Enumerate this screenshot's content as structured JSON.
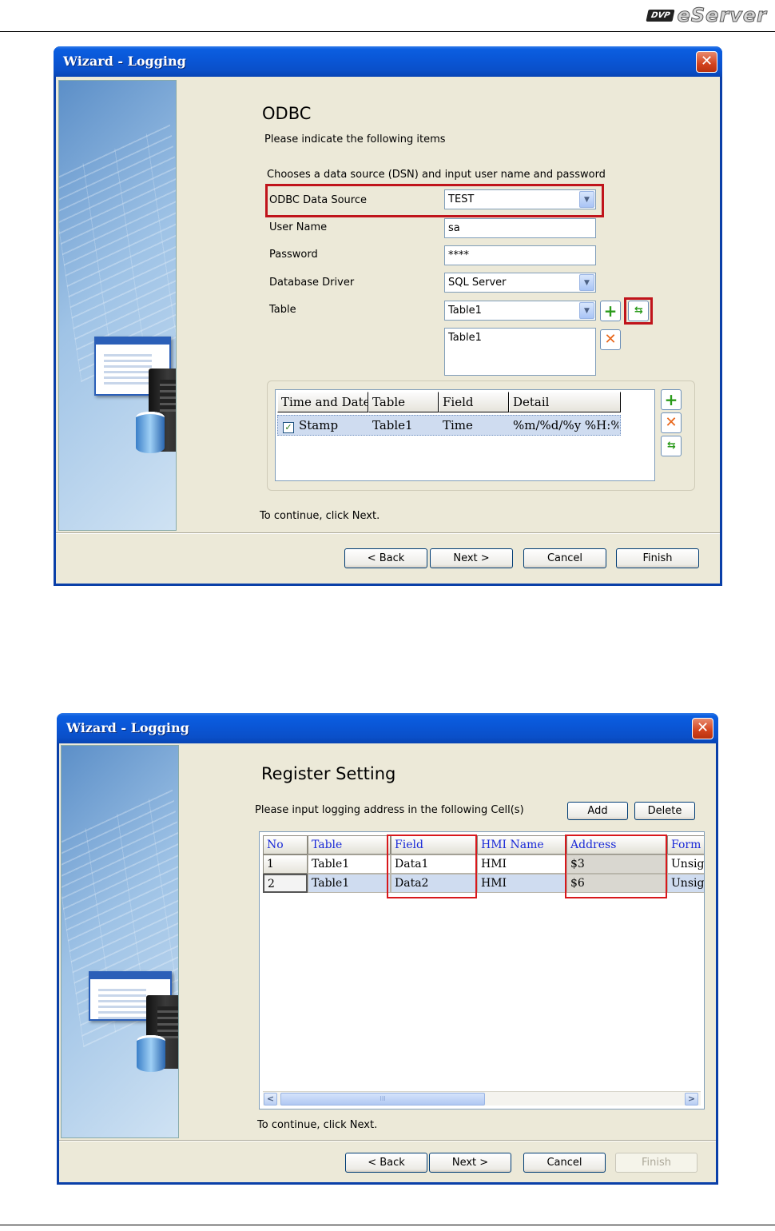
{
  "header": {
    "brand_badge": "DVP",
    "brand_text": "eServer"
  },
  "dialog1": {
    "title": "Wizard - Logging",
    "close_icon": "close-icon",
    "heading": "ODBC",
    "subtitle": "Please indicate the following items",
    "instruction": "Chooses a data source (DSN) and input user name and password",
    "fields": {
      "odbc_label": "ODBC Data Source",
      "odbc_value": "TEST",
      "user_label": "User Name",
      "user_value": "sa",
      "password_label": "Password",
      "password_value": "****",
      "driver_label": "Database Driver",
      "driver_value": "SQL Server",
      "table_label": "Table",
      "table_value": "Table1",
      "table_list_item": "Table1"
    },
    "grid": {
      "columns": [
        "Time and Date",
        "Table",
        "Field",
        "Detail"
      ],
      "rows": [
        {
          "time_and_date": "Stamp",
          "checked": true,
          "table": "Table1",
          "field": "Time",
          "detail": "%m/%d/%y %H:%M"
        }
      ]
    },
    "footer_text": "To continue, click Next.",
    "buttons": {
      "back": "< Back",
      "next": "Next >",
      "cancel": "Cancel",
      "finish": "Finish"
    }
  },
  "dialog2": {
    "title": "Wizard - Logging",
    "close_icon": "close-icon",
    "heading": "Register Setting",
    "instruction": "Please input logging address in the following Cell(s)",
    "add_label": "Add",
    "delete_label": "Delete",
    "table": {
      "columns": [
        "No",
        "Table",
        "Field",
        "HMI Name",
        "Address",
        "Form"
      ],
      "rows": [
        {
          "no": "1",
          "table": "Table1",
          "field": "Data1",
          "hmi_name": "HMI",
          "address": "$3",
          "format": "Unsig"
        },
        {
          "no": "2",
          "table": "Table1",
          "field": "Data2",
          "hmi_name": "HMI",
          "address": "$6",
          "format": "Unsig"
        }
      ]
    },
    "scroll_thumb_grip": "III",
    "footer_text": "To continue, click Next.",
    "buttons": {
      "back": "< Back",
      "next": "Next >",
      "cancel": "Cancel",
      "finish": "Finish"
    }
  },
  "colors": {
    "xp_title_blue": "#0a56d6",
    "highlight_red": "#c0141b",
    "column_header_text": "#1a2ad8"
  }
}
